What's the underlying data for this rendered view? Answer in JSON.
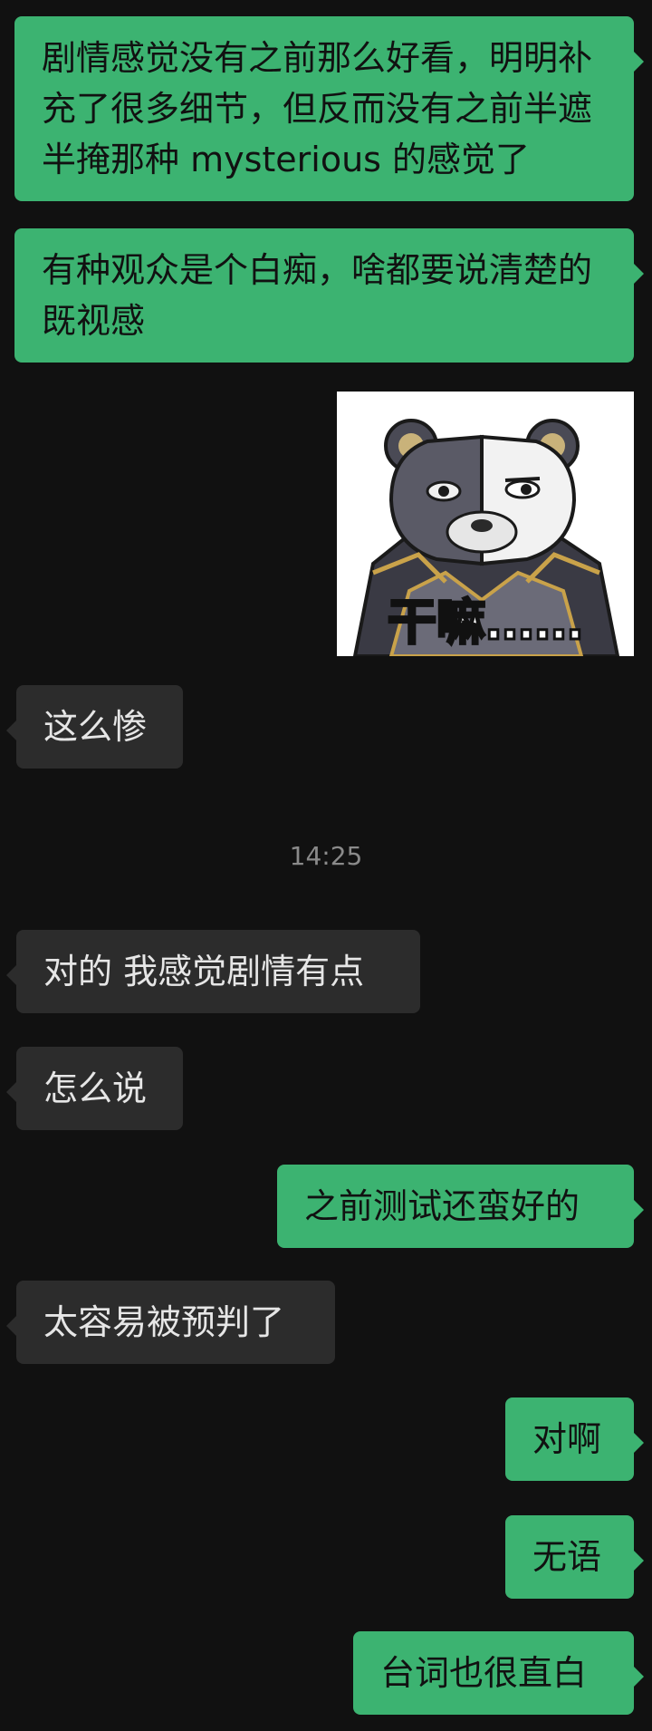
{
  "colors": {
    "background": "#111111",
    "outgoing_bubble": "#3CB371",
    "incoming_bubble": "#2c2c2c",
    "incoming_text": "#e6e6e6",
    "timestamp_text": "#8a8a8a"
  },
  "messages": [
    {
      "direction": "out",
      "text": "剧情感觉没有之前那么好看，明明补充了很多细节，但反而没有之前半遮半掩那种 mysterious 的感觉了"
    },
    {
      "direction": "out",
      "text": "有种观众是个白痴，啥都要说清楚的既视感"
    },
    {
      "direction": "out",
      "type": "sticker",
      "sticker_icon": "bear-sticker-icon",
      "caption": "干嘛……"
    },
    {
      "direction": "in",
      "text": "这么惨"
    },
    {
      "direction": "in",
      "text": "对的 我感觉剧情有点"
    },
    {
      "direction": "in",
      "text": "怎么说"
    },
    {
      "direction": "out",
      "text": "之前测试还蛮好的"
    },
    {
      "direction": "in",
      "text": "太容易被预判了"
    },
    {
      "direction": "out",
      "text": "对啊"
    },
    {
      "direction": "out",
      "text": "无语"
    },
    {
      "direction": "out",
      "text": "台词也很直白"
    }
  ],
  "timestamp": "14:25"
}
